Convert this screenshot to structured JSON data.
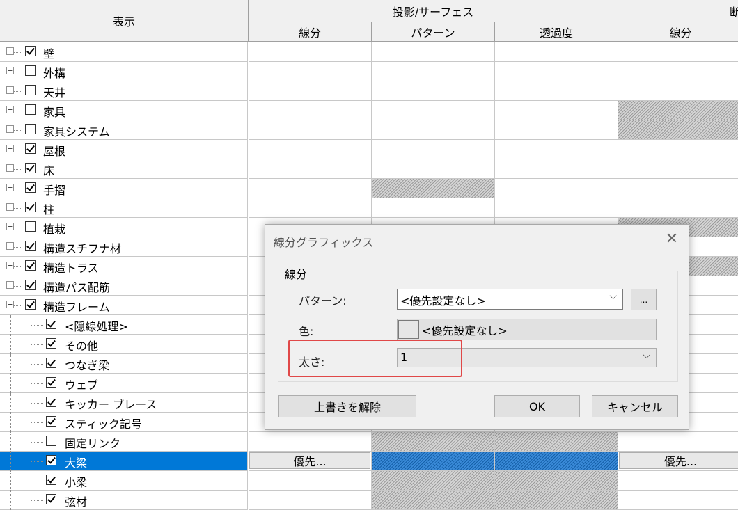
{
  "header": {
    "display": "表示",
    "projection_surface": "投影/サーフェス",
    "cut_partial": "断",
    "columns": [
      "線分",
      "パターン",
      "透過度",
      "線分"
    ]
  },
  "rows": [
    {
      "label": "壁",
      "checked": true,
      "level": 0
    },
    {
      "label": "外構",
      "checked": false,
      "level": 0
    },
    {
      "label": "天井",
      "checked": false,
      "level": 0
    },
    {
      "label": "家具",
      "checked": false,
      "level": 0
    },
    {
      "label": "家具システム",
      "checked": false,
      "level": 0
    },
    {
      "label": "屋根",
      "checked": true,
      "level": 0
    },
    {
      "label": "床",
      "checked": true,
      "level": 0
    },
    {
      "label": "手摺",
      "checked": true,
      "level": 0
    },
    {
      "label": "柱",
      "checked": true,
      "level": 0
    },
    {
      "label": "植栽",
      "checked": false,
      "level": 0
    },
    {
      "label": "構造スチフナ材",
      "checked": true,
      "level": 0
    },
    {
      "label": "構造トラス",
      "checked": true,
      "level": 0
    },
    {
      "label": "構造パス配筋",
      "checked": true,
      "level": 0
    },
    {
      "label": "構造フレーム",
      "checked": true,
      "level": 0,
      "expanded": true
    },
    {
      "label": "<隠線処理>",
      "checked": true,
      "level": 1
    },
    {
      "label": "その他",
      "checked": true,
      "level": 1
    },
    {
      "label": "つなぎ梁",
      "checked": true,
      "level": 1
    },
    {
      "label": "ウェブ",
      "checked": true,
      "level": 1
    },
    {
      "label": "キッカー ブレース",
      "checked": true,
      "level": 1
    },
    {
      "label": "スティック記号",
      "checked": true,
      "level": 1
    },
    {
      "label": "固定リンク",
      "checked": false,
      "level": 1
    },
    {
      "label": "大梁",
      "checked": true,
      "level": 1,
      "selected": true
    },
    {
      "label": "小梁",
      "checked": true,
      "level": 1
    },
    {
      "label": "弦材",
      "checked": true,
      "level": 1
    }
  ],
  "override_label": "優先...",
  "dialog": {
    "title": "線分グラフィックス",
    "group_label": "線分",
    "pattern_label": "パターン:",
    "pattern_value": "<優先設定なし>",
    "browse_label": "...",
    "color_label": "色:",
    "color_value": "<優先設定なし>",
    "weight_label": "太さ:",
    "weight_value": "1",
    "clear_button": "上書きを解除",
    "ok_button": "OK",
    "cancel_button": "キャンセル"
  },
  "colors": {
    "selection": "#0078d7",
    "highlight_box": "#e04848"
  }
}
